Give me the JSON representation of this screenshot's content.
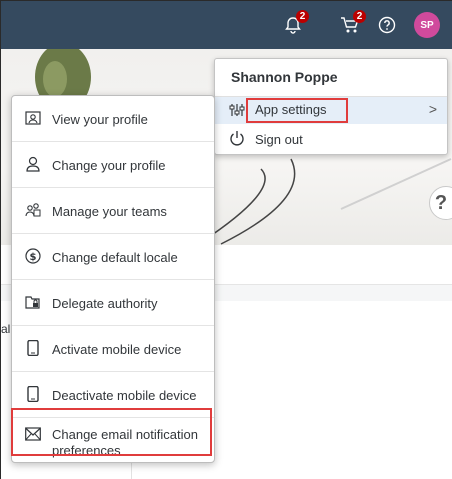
{
  "shell": {
    "notifications_badge": "2",
    "cart_badge": "2",
    "avatar_initials": "SP"
  },
  "user_menu": {
    "user_name": "Shannon Poppe",
    "app_settings_label": "App settings",
    "chevron": ">",
    "sign_out_label": "Sign out"
  },
  "settings_menu": {
    "items": [
      {
        "label": "View your profile",
        "icon": "profile-card-icon"
      },
      {
        "label": "Change your profile",
        "icon": "person-icon"
      },
      {
        "label": "Manage your teams",
        "icon": "team-icon"
      },
      {
        "label": "Change default locale",
        "icon": "currency-icon"
      },
      {
        "label": "Delegate authority",
        "icon": "locked-folder-icon"
      },
      {
        "label": "Activate mobile device",
        "icon": "mobile-icon"
      },
      {
        "label": "Deactivate mobile device",
        "icon": "mobile-icon"
      },
      {
        "label": "Change email notification preferences",
        "icon": "envelope-icon"
      }
    ]
  },
  "background": {
    "help_glyph": "?",
    "cut_text": "al"
  },
  "colors": {
    "shellbar": "#354a5f",
    "badge": "#bb0000",
    "avatar": "#d04a9c",
    "highlight_box": "#e03c3c",
    "selected_row": "#e5eef8"
  }
}
